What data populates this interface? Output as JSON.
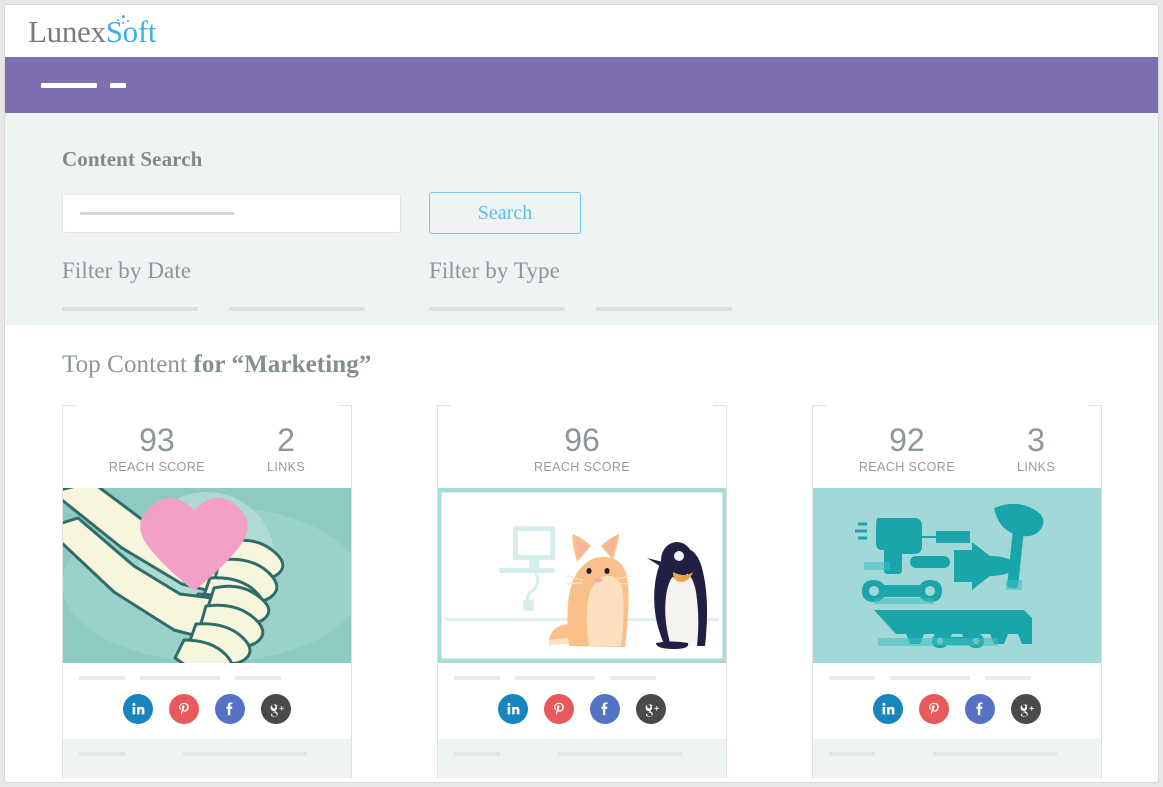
{
  "brand": {
    "name_part1": "Lunex",
    "name_part2": "Soft",
    "accent_color": "#3eaef0",
    "gray_color": "#7b7b7b"
  },
  "navbar": {
    "color": "#7e6fb0",
    "placeholders": 2
  },
  "search_panel": {
    "background": "#eef3f3",
    "title": "Content Search",
    "input": {
      "value": "",
      "placeholder": ""
    },
    "search_button_label": "Search",
    "search_button_color": "#5bbcee",
    "filters": [
      {
        "label": "Filter by Date",
        "lines": 2
      },
      {
        "label": "Filter by Type",
        "lines": 2
      }
    ]
  },
  "results": {
    "title_regular": "Top Content ",
    "title_strong": "for “Marketing”",
    "cards": [
      {
        "reach_score": "93",
        "reach_label": "REACH SCORE",
        "links": "2",
        "links_label": "LINKS",
        "image": "hands-heart-illustration",
        "image_bg": "#8ecac3",
        "socials": [
          "linkedin-icon",
          "pinterest-icon",
          "facebook-icon",
          "googleplus-icon"
        ]
      },
      {
        "reach_score": "96",
        "reach_label": "REACH SCORE",
        "links": null,
        "links_label": null,
        "image": "cat-penguin-computer-illustration",
        "image_bg": "#ffffff",
        "socials": [
          "linkedin-icon",
          "pinterest-icon",
          "facebook-icon",
          "googleplus-icon"
        ]
      },
      {
        "reach_score": "92",
        "reach_label": "REACH SCORE",
        "links": "3",
        "links_label": "LINKS",
        "image": "tools-illustration",
        "image_bg": "#a3d8d8",
        "socials": [
          "linkedin-icon",
          "pinterest-icon",
          "facebook-icon",
          "googleplus-icon"
        ]
      }
    ]
  },
  "social_colors": {
    "linkedin": "#1985bd",
    "pinterest": "#e8595b",
    "facebook": "#5573c4",
    "googleplus": "#4a4a4a"
  }
}
